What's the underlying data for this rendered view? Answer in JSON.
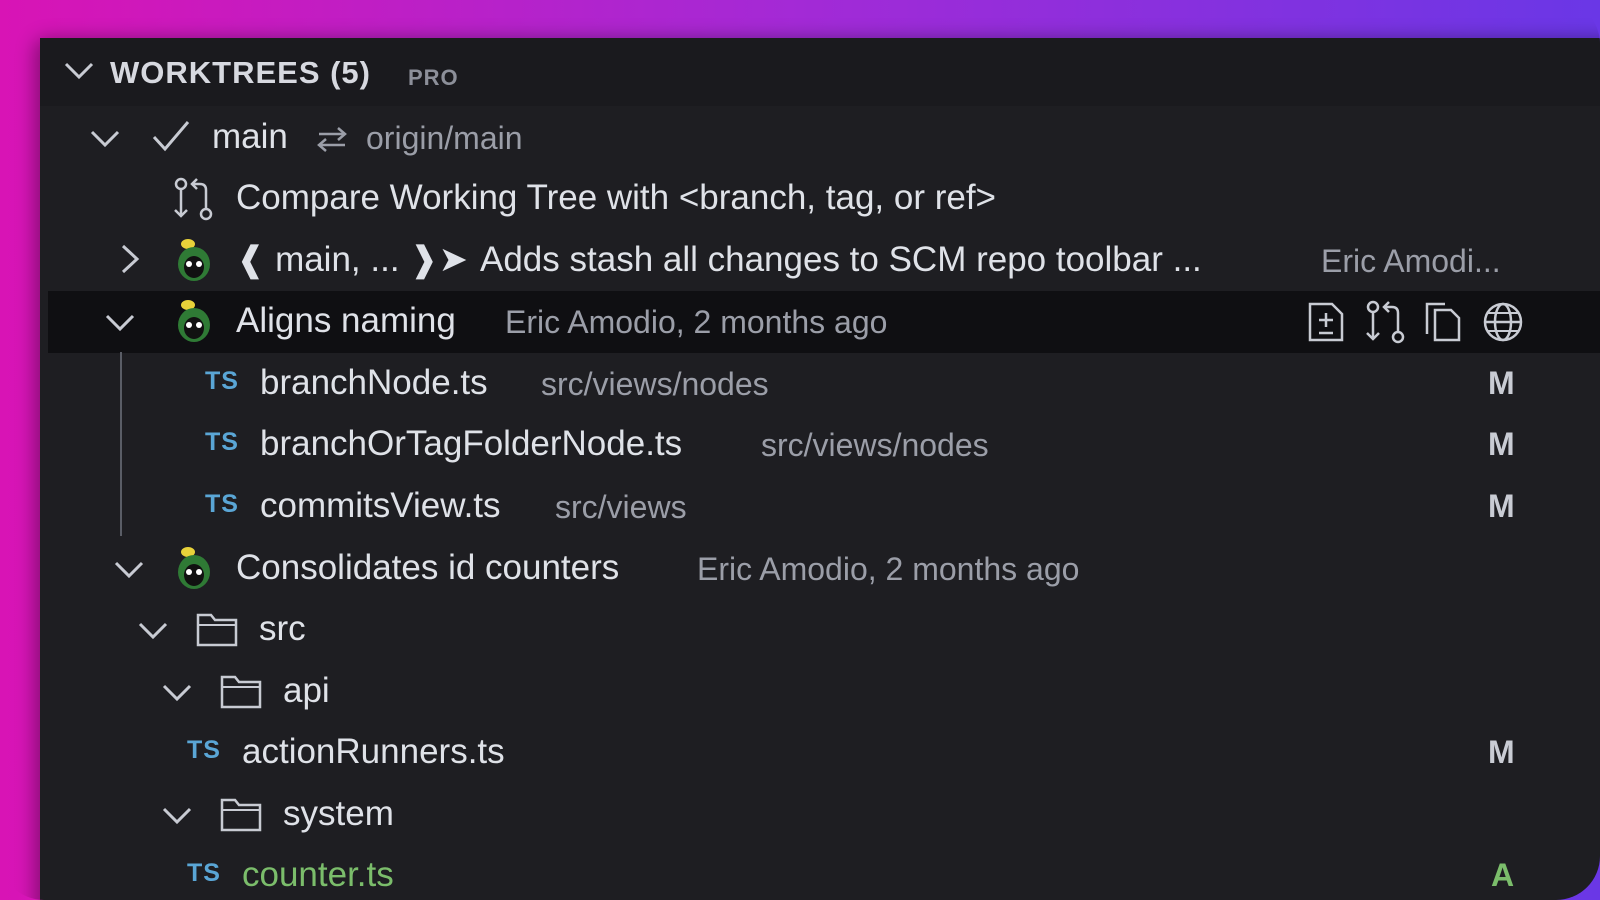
{
  "header": {
    "title": "WORKTREES (5)",
    "badge": "PRO"
  },
  "worktree": {
    "branch": "main",
    "upstream": "origin/main",
    "compare_label": "Compare Working Tree with <branch, tag, or ref>"
  },
  "commits": [
    {
      "refs_label": "main, ...",
      "message": "Adds stash all changes to SCM repo toolbar ...",
      "author": "Eric Amodi..."
    },
    {
      "message": "Aligns naming",
      "author_time": "Eric Amodio, 2 months ago",
      "files": [
        {
          "lang": "TS",
          "name": "branchNode.ts",
          "path": "src/views/nodes",
          "status": "M"
        },
        {
          "lang": "TS",
          "name": "branchOrTagFolderNode.ts",
          "path": "src/views/nodes",
          "status": "M"
        },
        {
          "lang": "TS",
          "name": "commitsView.ts",
          "path": "src/views",
          "status": "M"
        }
      ]
    },
    {
      "message": "Consolidates id counters",
      "author_time": "Eric Amodio, 2 months ago",
      "folders": {
        "src": "src",
        "api": "api",
        "system": "system"
      },
      "files": [
        {
          "lang": "TS",
          "name": "actionRunners.ts",
          "status": "M"
        },
        {
          "lang": "TS",
          "name": "counter.ts",
          "status": "A"
        }
      ]
    }
  ],
  "colors": {
    "panel_bg": "#1e1e22",
    "selected_bg": "#0f0f12",
    "ts_badge": "#5aa6d6",
    "added": "#7bbd6b"
  },
  "icons": [
    "chevron-down-icon",
    "chevron-right-icon",
    "checkmark-icon",
    "sync-arrows-icon",
    "compare-icon",
    "avatar",
    "open-changes-icon",
    "compare-with-head-icon",
    "copy-icon",
    "globe-icon",
    "folder-icon"
  ]
}
